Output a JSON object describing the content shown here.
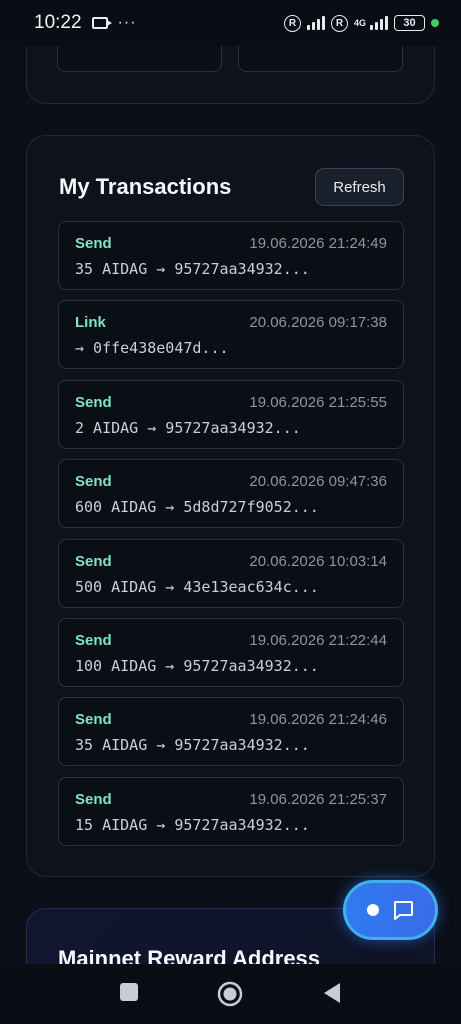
{
  "status_bar": {
    "time": "10:22",
    "dots": "···",
    "r1": "R",
    "r2": "R",
    "network": "4G",
    "battery": "30"
  },
  "transactions": {
    "title": "My Transactions",
    "refresh_label": "Refresh",
    "items": [
      {
        "type": "Send",
        "date": "19.06.2026 21:24:49",
        "detail": "35 AIDAG → 95727aa34932..."
      },
      {
        "type": "Link",
        "date": "20.06.2026 09:17:38",
        "detail": "→ 0ffe438e047d..."
      },
      {
        "type": "Send",
        "date": "19.06.2026 21:25:55",
        "detail": "2 AIDAG → 95727aa34932..."
      },
      {
        "type": "Send",
        "date": "20.06.2026 09:47:36",
        "detail": "600 AIDAG → 5d8d727f9052..."
      },
      {
        "type": "Send",
        "date": "20.06.2026 10:03:14",
        "detail": "500 AIDAG → 43e13eac634c..."
      },
      {
        "type": "Send",
        "date": "19.06.2026 21:22:44",
        "detail": "100 AIDAG → 95727aa34932..."
      },
      {
        "type": "Send",
        "date": "19.06.2026 21:24:46",
        "detail": "35 AIDAG → 95727aa34932..."
      },
      {
        "type": "Send",
        "date": "19.06.2026 21:25:37",
        "detail": "15 AIDAG → 95727aa34932..."
      }
    ]
  },
  "reward": {
    "title": "Mainnet Reward Address"
  },
  "icons": {
    "chat": "chat-bubble-icon",
    "nav_square": "square-icon",
    "nav_home": "circle-home-icon",
    "nav_back": "triangle-back-icon"
  },
  "colors": {
    "background": "#0b0f17",
    "accent_type": "#7fe3c6",
    "fab_blue": "#2f7bf0"
  }
}
